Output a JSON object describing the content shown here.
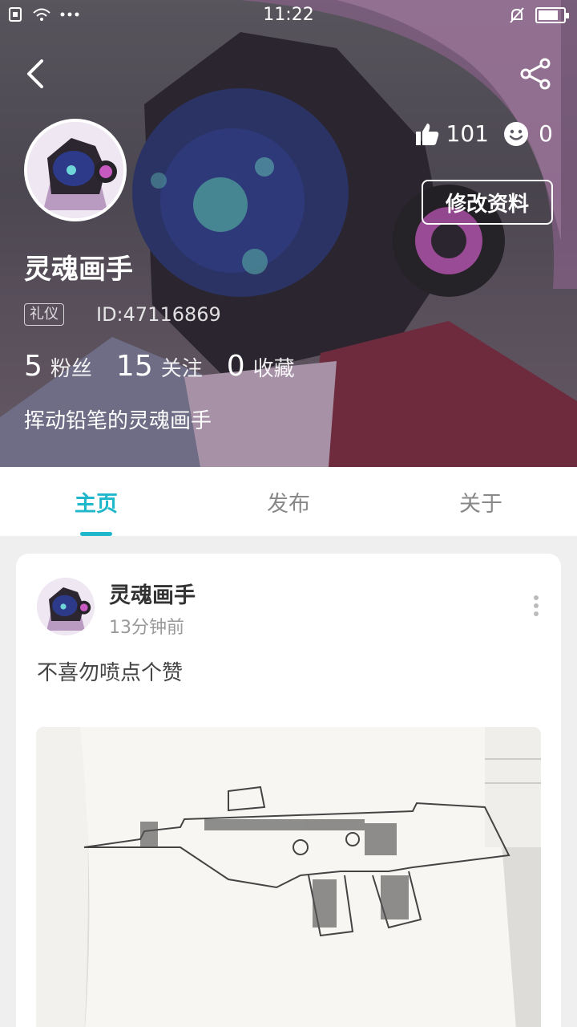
{
  "status_bar": {
    "time": "11:22"
  },
  "profile": {
    "username": "灵魂画手",
    "tag": "礼仪",
    "user_id": "ID:47116869",
    "likes": "101",
    "emotes": "0",
    "edit_button": "修改资料",
    "bio": "挥动铅笔的灵魂画手",
    "stats": [
      {
        "value": "5",
        "label": "粉丝"
      },
      {
        "value": "15",
        "label": "关注"
      },
      {
        "value": "0",
        "label": "收藏"
      }
    ]
  },
  "tabs": [
    {
      "label": "主页",
      "active": true
    },
    {
      "label": "发布",
      "active": false
    },
    {
      "label": "关于",
      "active": false
    }
  ],
  "post": {
    "author": "灵魂画手",
    "time": "13分钟前",
    "text": "不喜勿喷点个赞"
  },
  "colors": {
    "accent": "#1fb7c9"
  }
}
